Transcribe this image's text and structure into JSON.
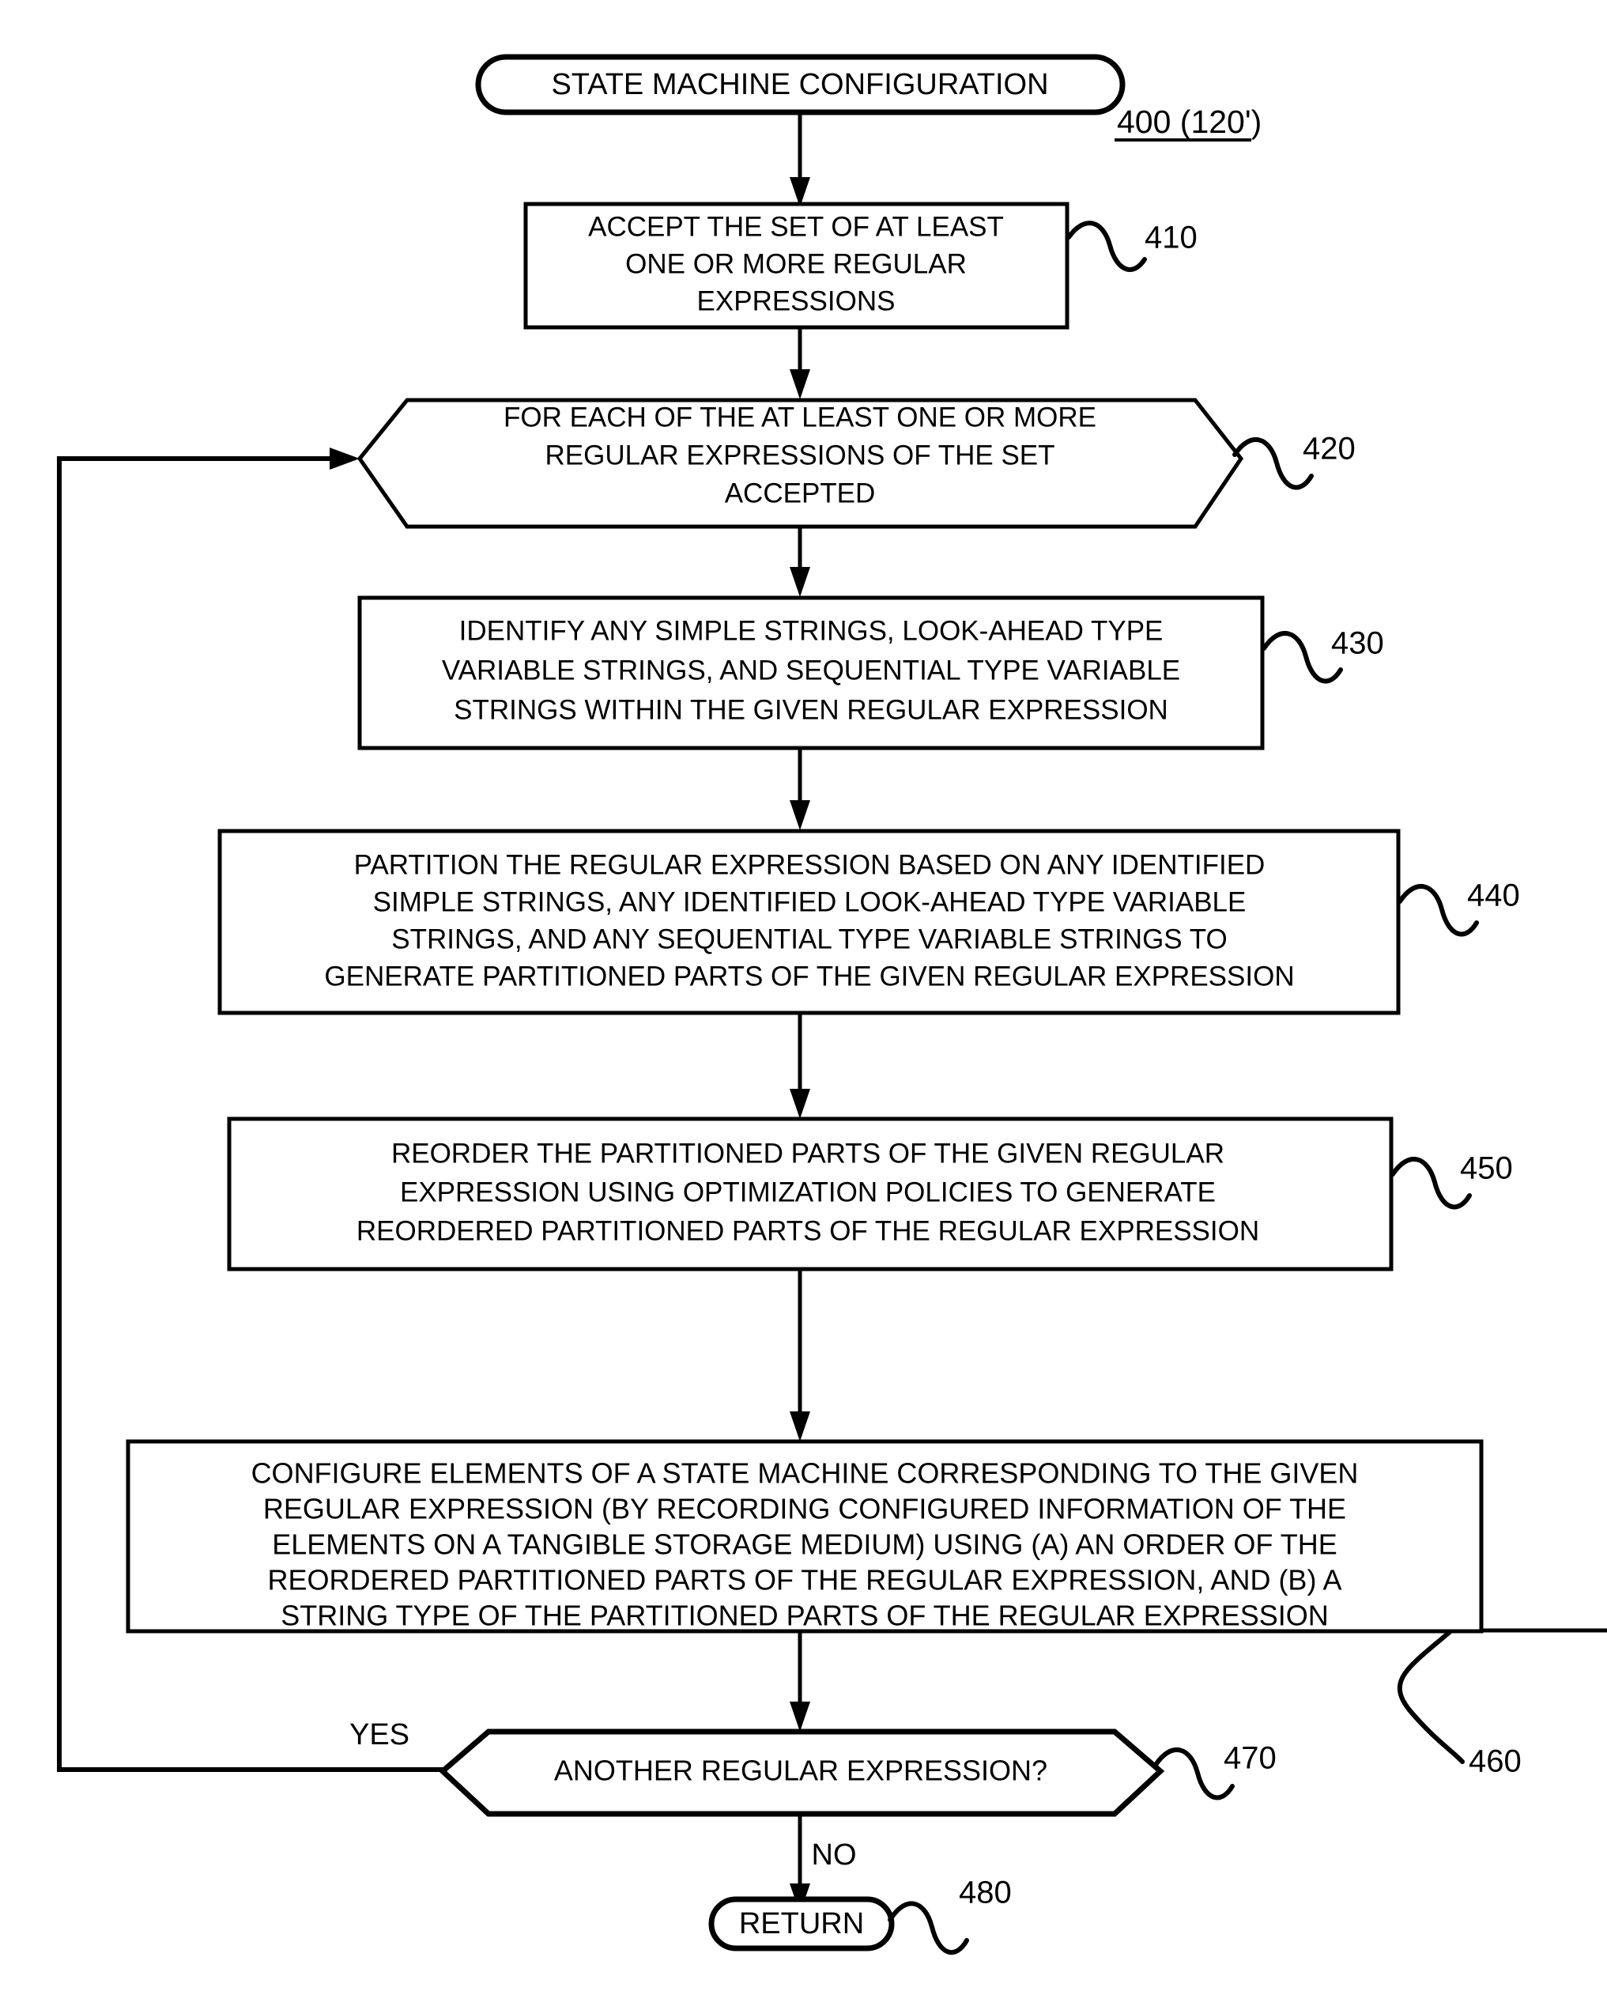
{
  "figure": {
    "type": "flowchart",
    "title_label": "400 (120')",
    "background": "#ffffff",
    "line_color": "#000000"
  },
  "nodes": {
    "start": {
      "shape": "terminal",
      "text": "STATE MACHINE CONFIGURATION",
      "ref": ""
    },
    "step410": {
      "shape": "process",
      "ref": "410",
      "lines": [
        "ACCEPT THE SET OF AT LEAST",
        "ONE OR MORE REGULAR",
        "EXPRESSIONS"
      ]
    },
    "step420": {
      "shape": "loop-hexagon",
      "ref": "420",
      "lines": [
        "FOR EACH OF THE AT LEAST ONE OR MORE",
        "REGULAR EXPRESSIONS OF THE SET",
        "ACCEPTED"
      ]
    },
    "step430": {
      "shape": "process",
      "ref": "430",
      "lines": [
        "IDENTIFY ANY SIMPLE STRINGS, LOOK-AHEAD TYPE",
        "VARIABLE STRINGS, AND SEQUENTIAL TYPE VARIABLE",
        "STRINGS WITHIN THE GIVEN REGULAR EXPRESSION"
      ]
    },
    "step440": {
      "shape": "process",
      "ref": "440",
      "lines": [
        "PARTITION THE REGULAR EXPRESSION BASED ON ANY IDENTIFIED",
        "SIMPLE STRINGS, ANY IDENTIFIED LOOK-AHEAD TYPE VARIABLE",
        "STRINGS, AND ANY SEQUENTIAL TYPE VARIABLE STRINGS TO",
        "GENERATE PARTITIONED PARTS OF THE GIVEN REGULAR EXPRESSION"
      ]
    },
    "step450": {
      "shape": "process",
      "ref": "450",
      "lines": [
        "REORDER THE PARTITIONED PARTS OF THE GIVEN REGULAR",
        "EXPRESSION USING OPTIMIZATION POLICIES TO GENERATE",
        "REORDERED PARTITIONED PARTS OF THE REGULAR EXPRESSION"
      ]
    },
    "step460": {
      "shape": "process",
      "ref": "460",
      "lines": [
        "CONFIGURE ELEMENTS OF A STATE MACHINE CORRESPONDING TO THE GIVEN",
        "REGULAR EXPRESSION (BY RECORDING CONFIGURED INFORMATION OF THE",
        "ELEMENTS ON A TANGIBLE STORAGE MEDIUM) USING (A) AN ORDER OF THE",
        "REORDERED PARTITIONED PARTS OF THE REGULAR EXPRESSION, AND (B) A",
        "STRING TYPE OF THE PARTITIONED PARTS OF THE REGULAR EXPRESSION"
      ]
    },
    "step470": {
      "shape": "decision-hexagon",
      "ref": "470",
      "text": "ANOTHER REGULAR EXPRESSION?"
    },
    "step480": {
      "shape": "terminal",
      "ref": "480",
      "text": "RETURN"
    }
  },
  "edge_labels": {
    "yes": "YES",
    "no": "NO"
  }
}
